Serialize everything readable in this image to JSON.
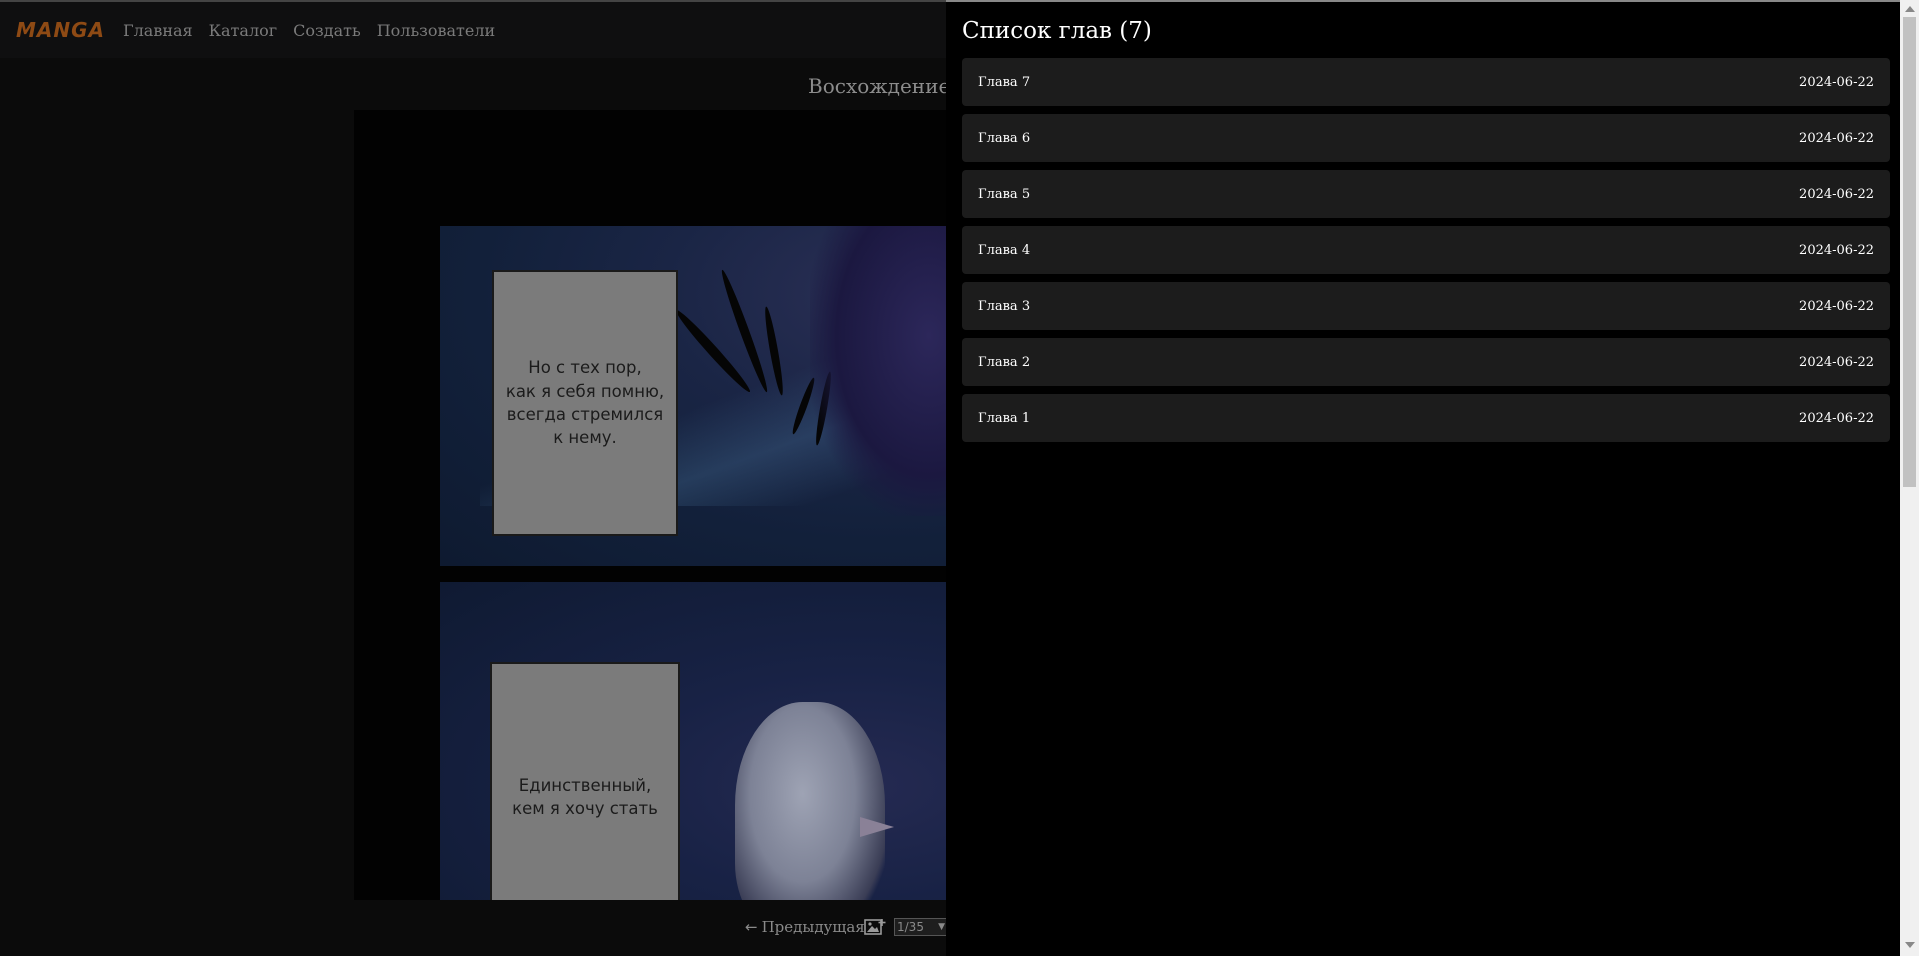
{
  "header": {
    "brand": "MANGA",
    "nav": [
      "Главная",
      "Каталог",
      "Создать",
      "Пользователи"
    ]
  },
  "reader": {
    "title": "Восхождение",
    "panel_text": [
      "Но с тех пор,\nкак я себя помню,\nвсегда стремился\nк нему.",
      "Единственный,\nкем я хочу стать"
    ],
    "prev_label": "Предыдущая",
    "page_select_value": "1/35"
  },
  "drawer": {
    "title": "Список глав (7)",
    "chapters": [
      {
        "name": "Глава 7",
        "date": "2024-06-22"
      },
      {
        "name": "Глава 6",
        "date": "2024-06-22"
      },
      {
        "name": "Глава 5",
        "date": "2024-06-22"
      },
      {
        "name": "Глава 4",
        "date": "2024-06-22"
      },
      {
        "name": "Глава 3",
        "date": "2024-06-22"
      },
      {
        "name": "Глава 2",
        "date": "2024-06-22"
      },
      {
        "name": "Глава 1",
        "date": "2024-06-22"
      }
    ]
  },
  "colors": {
    "brand": "#8e4a14",
    "drawer_bg": "#000000",
    "chapter_item_bg": "#1c1c1c"
  },
  "icons": [
    "arrow-left-icon",
    "image-add-icon",
    "chevron-down-icon"
  ]
}
